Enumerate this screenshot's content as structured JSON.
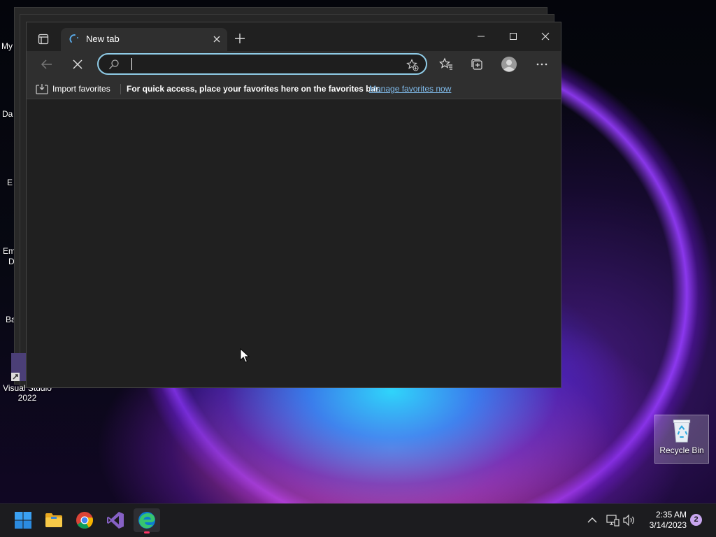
{
  "desktop": {
    "icons": [
      {
        "label": "Visual Studio 2022"
      },
      {
        "label": "Recycle Bin"
      }
    ],
    "partial_labels": [
      "My",
      "Da",
      "E",
      "Em",
      "D",
      "Ba"
    ]
  },
  "browser": {
    "tab": {
      "title": "New tab"
    },
    "address_bar": {
      "value": "",
      "placeholder": ""
    },
    "favorites_bar": {
      "import_label": "Import favorites",
      "hint": "For quick access, place your favorites here on the favorites bar.",
      "manage_link": "Manage favorites now"
    }
  },
  "taskbar": {
    "apps": [
      "start-icon",
      "file-explorer-icon",
      "chrome-icon",
      "visual-studio-icon",
      "edge-icon"
    ],
    "time": "2:35 AM",
    "date": "3/14/2023",
    "notification_count": "2"
  },
  "colors": {
    "accent_focus": "#8fcbe6",
    "link": "#7fb9e8",
    "badge": "#c8a6ef"
  }
}
